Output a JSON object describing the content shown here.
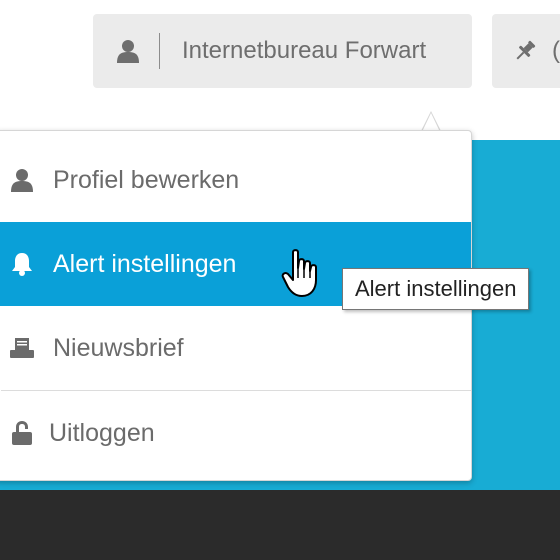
{
  "header": {
    "account_label": "Internetbureau Forwart",
    "account_icon": "user-icon",
    "pin_label": "(",
    "pin_icon": "pin-icon"
  },
  "menu": {
    "items": [
      {
        "label": "Profiel bewerken",
        "icon": "user-icon"
      },
      {
        "label": "Alert instellingen",
        "icon": "bell-icon",
        "active": true
      },
      {
        "label": "Nieuwsbrief",
        "icon": "newsletter-icon"
      },
      {
        "label": "Uitloggen",
        "icon": "lock-icon"
      }
    ]
  },
  "tooltip": {
    "text": "Alert instellingen"
  },
  "colors": {
    "active_bg": "#0aa0d8",
    "panel_bg": "#18acd4",
    "footer_bg": "#2b2b2b",
    "button_bg": "#ebebeb"
  }
}
